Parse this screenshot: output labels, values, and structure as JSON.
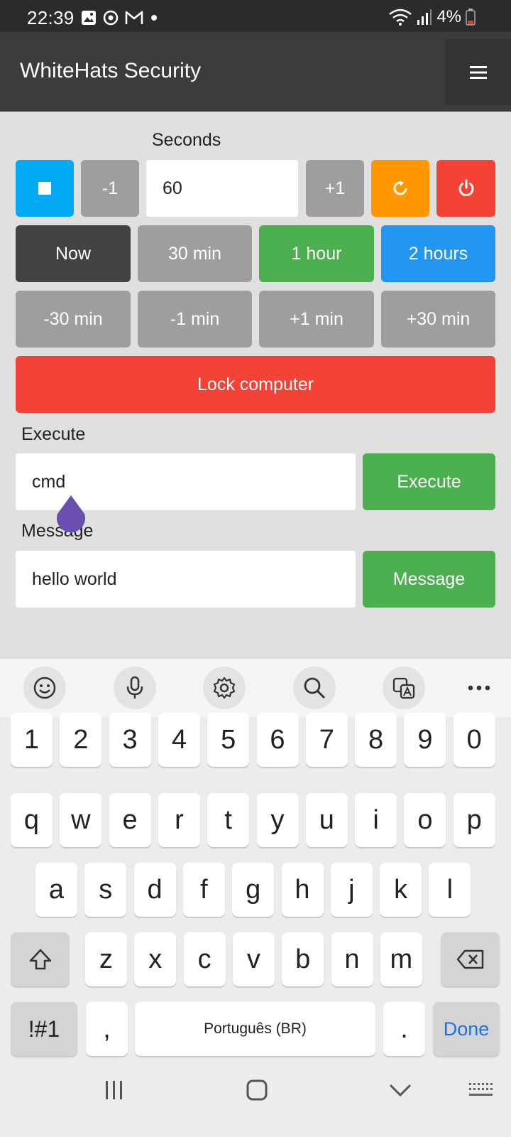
{
  "status_bar": {
    "time": "22:39",
    "battery": "4%"
  },
  "app_bar": {
    "title": "WhiteHats Security",
    "menu_icon": "hamburger-menu-icon"
  },
  "timer": {
    "seconds_label": "Seconds",
    "seconds_value": "60",
    "minus_one": "-1",
    "plus_one": "+1",
    "stop_color": "#03a9f4",
    "restart_color": "#ff9800",
    "power_color": "#f44336"
  },
  "presets": [
    "Now",
    "30 min",
    "1 hour",
    "2 hours"
  ],
  "adjust": [
    "-30 min",
    "-1 min",
    "+1 min",
    "+30 min"
  ],
  "lock_label": "Lock computer",
  "execute": {
    "label": "Execute",
    "value": "cmd",
    "button": "Execute"
  },
  "message": {
    "label": "Message",
    "value": "hello world",
    "button": "Message"
  },
  "keyboard": {
    "row_numbers": [
      "1",
      "2",
      "3",
      "4",
      "5",
      "6",
      "7",
      "8",
      "9",
      "0"
    ],
    "row_top": [
      "q",
      "w",
      "e",
      "r",
      "t",
      "y",
      "u",
      "i",
      "o",
      "p"
    ],
    "row_middle": [
      "a",
      "s",
      "d",
      "f",
      "g",
      "h",
      "j",
      "k",
      "l"
    ],
    "row_bottom": [
      "z",
      "x",
      "c",
      "v",
      "b",
      "n",
      "m"
    ],
    "symbols_key": "!#1",
    "comma_key": ",",
    "space_label": "Português (BR)",
    "period_key": ".",
    "done_key": "Done"
  },
  "colors": {
    "green": "#4caf50",
    "blue": "#2196f3",
    "dark": "#424242",
    "red": "#f44336",
    "accent_purple": "#6a4fb0"
  }
}
